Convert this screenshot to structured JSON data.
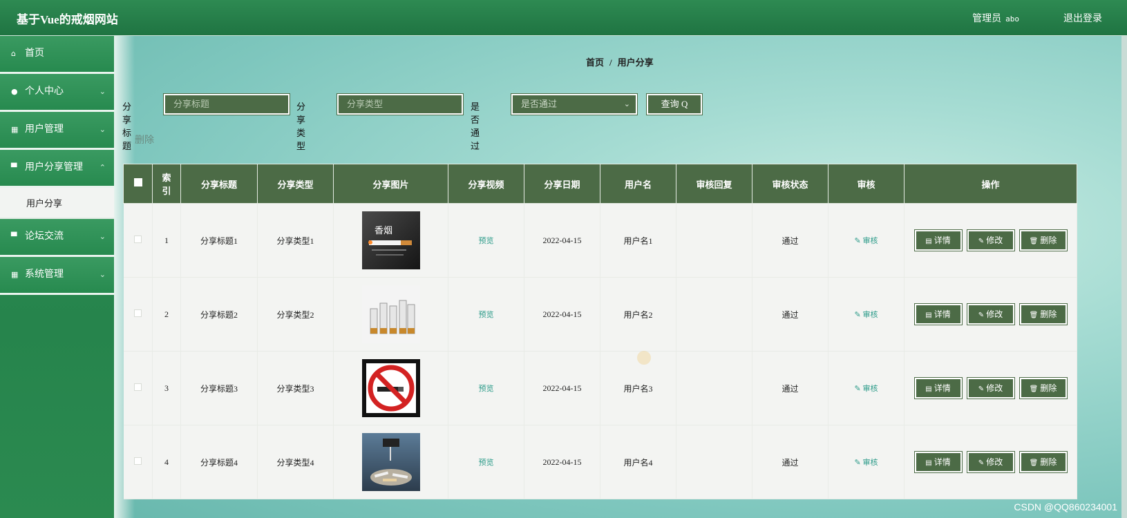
{
  "app": {
    "title": "基于Vue的戒烟网站",
    "role": "管理员",
    "username": "abo",
    "logout": "退出登录"
  },
  "sidebar": {
    "items": [
      {
        "label": "首页",
        "icon": "home-icon",
        "glyph": "⌂",
        "has_children": false
      },
      {
        "label": "个人中心",
        "icon": "user-icon",
        "glyph": "●",
        "has_children": true
      },
      {
        "label": "用户管理",
        "icon": "grid-icon",
        "glyph": "▦",
        "has_children": true
      },
      {
        "label": "用户分享管理",
        "icon": "document-icon",
        "glyph": "▀",
        "has_children": true,
        "expanded": true
      },
      {
        "label": "论坛交流",
        "icon": "chat-icon",
        "glyph": "▀",
        "has_children": true
      },
      {
        "label": "系统管理",
        "icon": "grid-icon",
        "glyph": "▦",
        "has_children": true
      }
    ],
    "submenu": {
      "label": "用户分享",
      "active": true
    }
  },
  "breadcrumb": {
    "home": "首页",
    "sep": "/",
    "current": "用户分享"
  },
  "search": {
    "title_label": "分享标题",
    "title_placeholder": "分享标题",
    "type_label": "分享类型",
    "type_placeholder": "分享类型",
    "pass_label": "是否通过",
    "pass_placeholder": "是否通过",
    "query_button": "查询 ",
    "query_icon": "Q"
  },
  "toolbar": {
    "delete": "删除"
  },
  "table": {
    "headers": [
      "索引",
      "分享标题",
      "分享类型",
      "分享图片",
      "分享视频",
      "分享日期",
      "用户名",
      "审核回复",
      "审核状态",
      "审核",
      "操作"
    ],
    "index_header_l1": "索",
    "index_header_l2": "引",
    "rows": [
      {
        "index": "1",
        "title": "分享标题1",
        "type": "分享类型1",
        "image": "cigarette-image",
        "video": "预览",
        "date": "2022-04-15",
        "user": "用户名1",
        "reply": "",
        "status": "通过",
        "audit": "审核"
      },
      {
        "index": "2",
        "title": "分享标题2",
        "type": "分享类型2",
        "image": "stop-cigarettes-image",
        "video": "预览",
        "date": "2022-04-15",
        "user": "用户名2",
        "reply": "",
        "status": "通过",
        "audit": "审核"
      },
      {
        "index": "3",
        "title": "分享标题3",
        "type": "分享类型3",
        "image": "no-smoking-sign-image",
        "video": "预览",
        "date": "2022-04-15",
        "user": "用户名3",
        "reply": "",
        "status": "通过",
        "audit": "审核"
      },
      {
        "index": "4",
        "title": "分享标题4",
        "type": "分享类型4",
        "image": "quit-sign-image",
        "video": "预览",
        "date": "2022-04-15",
        "user": "用户名4",
        "reply": "",
        "status": "通过",
        "audit": "审核"
      }
    ],
    "ops": {
      "detail": "详情",
      "edit": "修改",
      "delete": "删除"
    },
    "thumb_text": "香烟"
  },
  "watermark": "CSDN @QQ860234001",
  "colors": {
    "topbar": "#1f7442",
    "sidebar": "#2f8f56",
    "button": "#4c6b46",
    "link": "#2a9a88"
  }
}
